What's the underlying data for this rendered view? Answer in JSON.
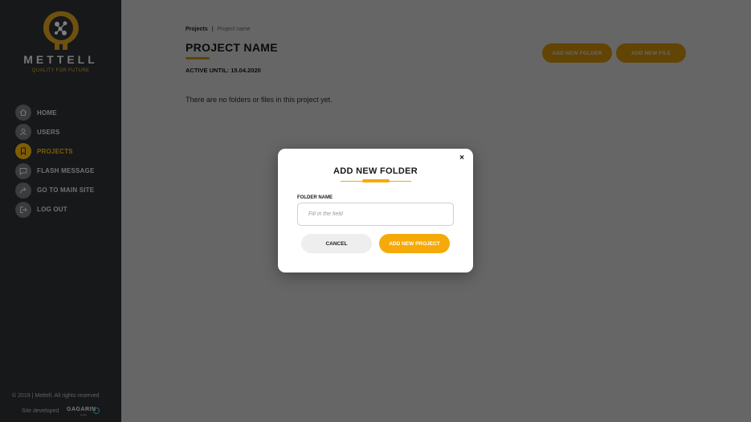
{
  "sidebar": {
    "brand": "METTELL",
    "tagline": "QUALITY FOR FUTURE",
    "items": [
      {
        "label": "HOME",
        "icon": "home-icon"
      },
      {
        "label": "USERS",
        "icon": "user-icon"
      },
      {
        "label": "PROJECTS",
        "icon": "bookmark-icon"
      },
      {
        "label": "FLASH MESSAGE",
        "icon": "message-icon"
      },
      {
        "label": "GO TO MAIN SITE",
        "icon": "share-icon"
      },
      {
        "label": "LOG OUT",
        "icon": "logout-icon"
      }
    ],
    "active_item": "PROJECTS",
    "footer": {
      "copyright": "© 2019    |    Mettell. All rights reserved",
      "developed": "Site developed",
      "developer": "GAGARIN",
      "developer_sub": "studio"
    }
  },
  "main": {
    "breadcrumb": {
      "home": "Projects",
      "separator": "|",
      "current": "Project name"
    },
    "title": "PROJECT NAME",
    "active_until": "ACTIVE UNTIL: 15.04.2020",
    "empty_message": "There are no folders or files in this project yet.",
    "buttons": {
      "add_folder": "ADD NEW FOLDER",
      "add_file": "ADD NEW FILE"
    }
  },
  "modal": {
    "close": "×",
    "title": "ADD NEW FOLDER",
    "field_label": "FOLDER NAME",
    "field_value": "",
    "field_placeholder": "Fill in the field",
    "cancel_label": "CANCEL",
    "submit_label": "ADD NEW PROJECT"
  },
  "colors": {
    "accent": "#f5aa0a",
    "sidebar_bg": "#2a2c30",
    "overlay": "rgba(0,0,0,0.6)"
  }
}
